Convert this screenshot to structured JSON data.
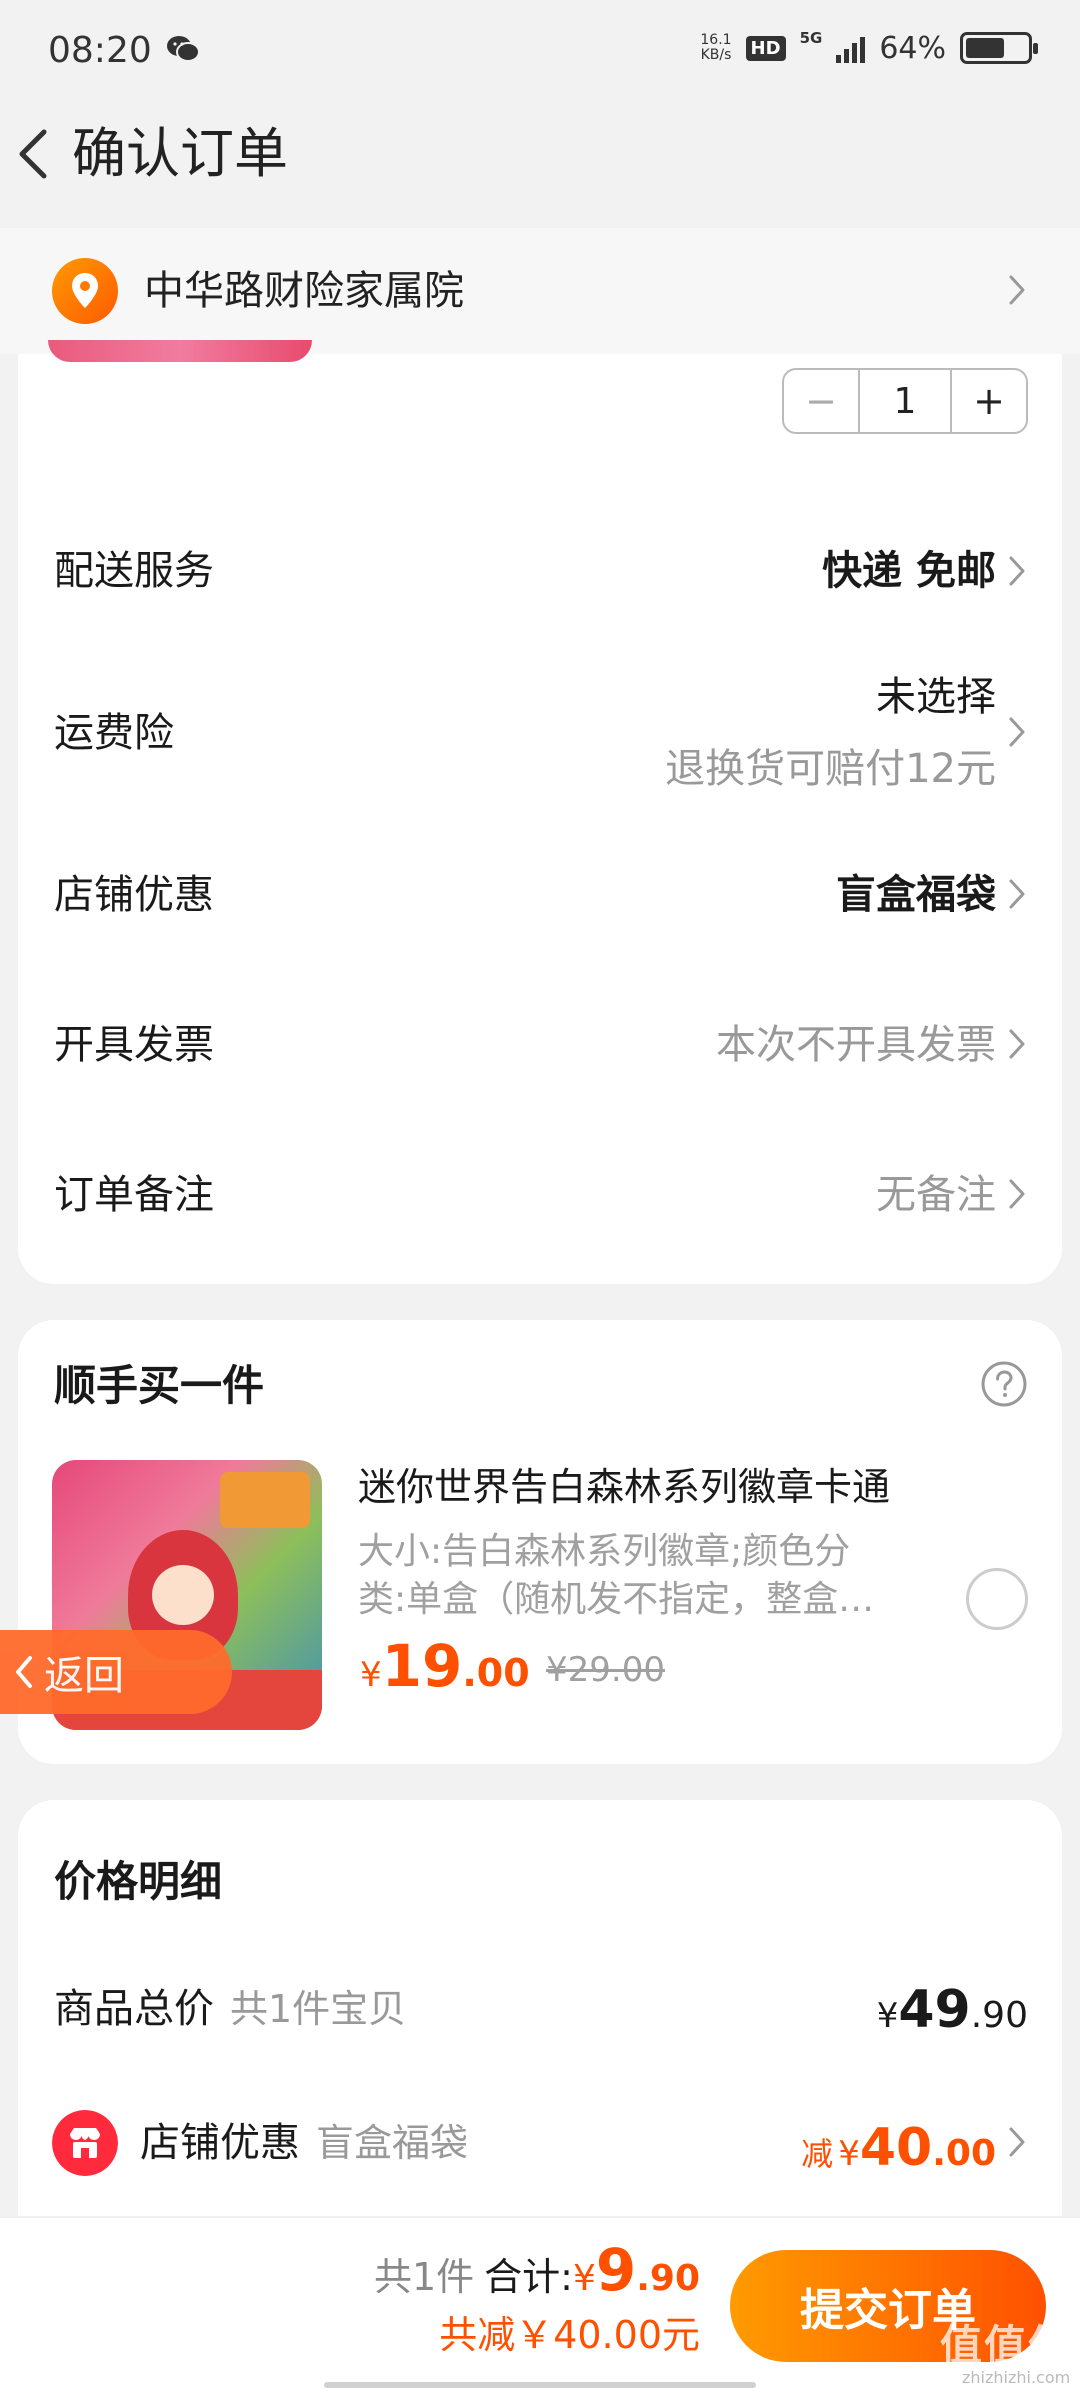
{
  "status_bar": {
    "time": "08:20",
    "net_speed_value": "16.1",
    "net_speed_unit": "KB/s",
    "hd_label": "HD",
    "network_label": "5G",
    "battery_percent": "64%",
    "battery_level": 0.64
  },
  "header": {
    "title": "确认订单"
  },
  "address": {
    "text": "中华路财险家属院"
  },
  "product": {
    "quantity": "1",
    "minus_label": "−",
    "plus_label": "+"
  },
  "order_rows": {
    "shipping": {
      "label": "配送服务",
      "value": "快递 免邮"
    },
    "insurance": {
      "label": "运费险",
      "value": "未选择",
      "sub": "退换货可赔付12元"
    },
    "shop_discount": {
      "label": "店铺优惠",
      "value": "盲盒福袋"
    },
    "invoice": {
      "label": "开具发票",
      "value": "本次不开具发票"
    },
    "remark": {
      "label": "订单备注",
      "value": "无备注"
    }
  },
  "addon": {
    "title": "顺手买一件",
    "item_name": "迷你世界告白森林系列徽章卡通",
    "item_desc_line1": "大小:告白森林系列徽章;颜色分",
    "item_desc_line2": "类:单盒（随机发不指定，整盒…",
    "price_currency": "¥",
    "price_int": "19",
    "price_dec": ".00",
    "orig_price": "¥29.00"
  },
  "floating_back": {
    "label": "返回"
  },
  "price_detail": {
    "title": "价格明细",
    "goods_total_label": "商品总价",
    "goods_total_sub": "共1件宝贝",
    "goods_total_currency": "¥",
    "goods_total_int": "49",
    "goods_total_dec": ".90",
    "shop_discount_label": "店铺优惠",
    "shop_discount_sub": "盲盒福袋",
    "discount_prefix": "减",
    "discount_currency": "¥",
    "discount_int": "40",
    "discount_dec": ".00"
  },
  "bottom_bar": {
    "count_text": "共1件",
    "total_label": "合计:",
    "total_currency": "¥",
    "total_int": "9",
    "total_dec": ".90",
    "saved_text": "共减￥40.00元",
    "submit_label": "提交订单"
  },
  "watermark": {
    "text": "值值值",
    "sub": "zhizhizhi.com"
  },
  "colors": {
    "accent": "#ff5000",
    "button_start": "#ff9b00",
    "button_end": "#ff5000",
    "shop_icon": "#ff2b3d"
  }
}
